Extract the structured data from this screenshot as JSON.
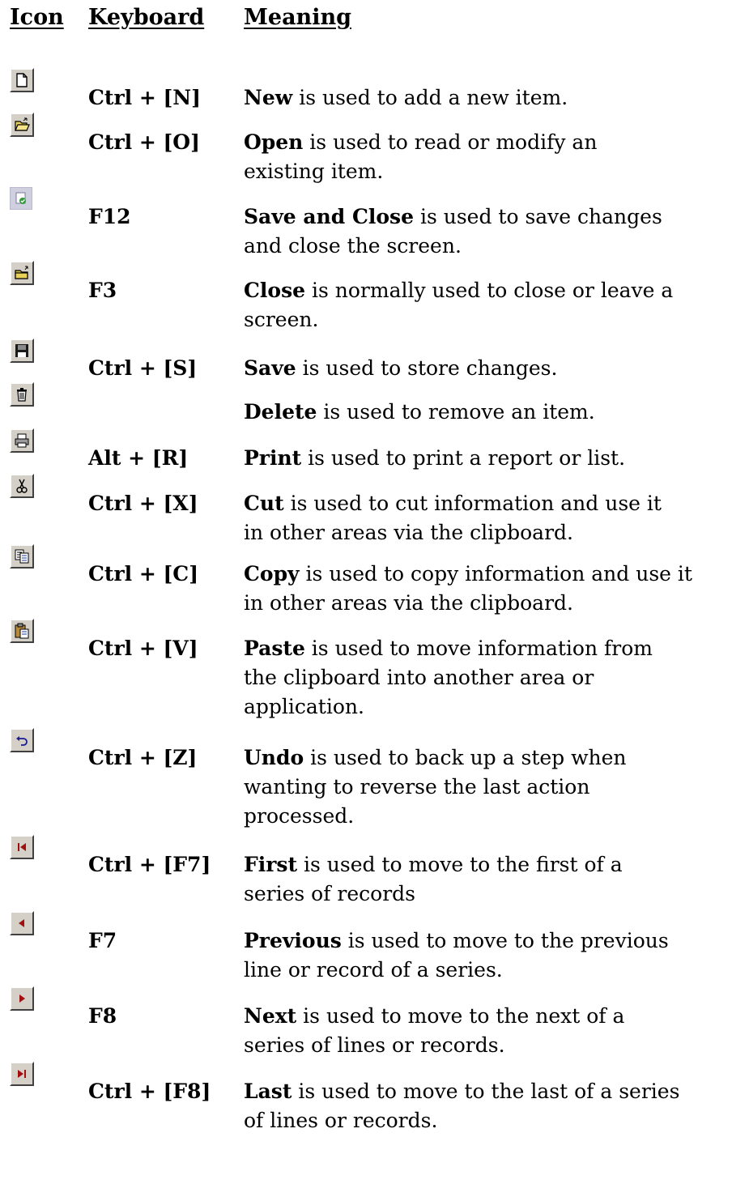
{
  "headers": {
    "icon": "Icon",
    "keyboard": "Keyboard",
    "meaning": "Meaning"
  },
  "rows": [
    {
      "icon": "new-document-icon",
      "key": "Ctrl + [N]",
      "name": "New",
      "desc": " is used to add a new item.",
      "desc2": ""
    },
    {
      "icon": "open-folder-icon",
      "key": "Ctrl + [O]",
      "name": "Open",
      "desc": " is used to read or modify an",
      "desc2": "existing item."
    },
    {
      "icon": "save-and-close-icon",
      "key": "F12",
      "name": "Save and Close",
      "desc": " is used to save changes",
      "desc2": "and close the screen."
    },
    {
      "icon": "close-folder-icon",
      "key": "F3",
      "name": "Close",
      "desc": " is normally used to close or leave a",
      "desc2": "screen."
    },
    {
      "icon": "floppy-disk-icon",
      "key": "Ctrl + [S]",
      "name": "Save",
      "desc": " is used to store changes.",
      "desc2": ""
    },
    {
      "icon": "trash-can-icon",
      "key": "",
      "name": "Delete",
      "desc": " is used to remove an item.",
      "desc2": ""
    },
    {
      "icon": "printer-icon",
      "key": "Alt + [R]",
      "name": "Print",
      "desc": " is used to print a report or list.",
      "desc2": ""
    },
    {
      "icon": "scissors-icon",
      "key": "Ctrl + [X]",
      "name": "Cut",
      "desc": " is used to cut information and use it",
      "desc2": "in other areas via the clipboard."
    },
    {
      "icon": "copy-icon",
      "key": "Ctrl + [C]",
      "name": "Copy",
      "desc": " is used to copy information and use it",
      "desc2": "in other areas via the clipboard."
    },
    {
      "icon": "paste-clipboard-icon",
      "key": "Ctrl + [V]",
      "name": "Paste",
      "desc": " is used to move information from",
      "desc2": "the clipboard into another area or",
      "desc3": "application."
    },
    {
      "icon": "undo-arrow-icon",
      "key": "Ctrl + [Z]",
      "name": "Undo",
      "desc": " is used to back up a step when",
      "desc2": "wanting to reverse the last action",
      "desc3": "processed."
    },
    {
      "icon": "first-record-icon",
      "key": "Ctrl + [F7]",
      "name": "First",
      "desc": " is used to move to the first of a",
      "desc2": "series of records"
    },
    {
      "icon": "previous-record-icon",
      "key": "F7",
      "name": "Previous",
      "desc": " is used to move to the previous",
      "desc2": "line or record of a series."
    },
    {
      "icon": "next-record-icon",
      "key": "F8",
      "name": "Next",
      "desc": " is used to move to the next of a",
      "desc2": "series of lines or records."
    },
    {
      "icon": "last-record-icon",
      "key": "Ctrl + [F8]",
      "name": "Last",
      "desc": " is used to move to the last of a series",
      "desc2": "of lines or records."
    }
  ]
}
